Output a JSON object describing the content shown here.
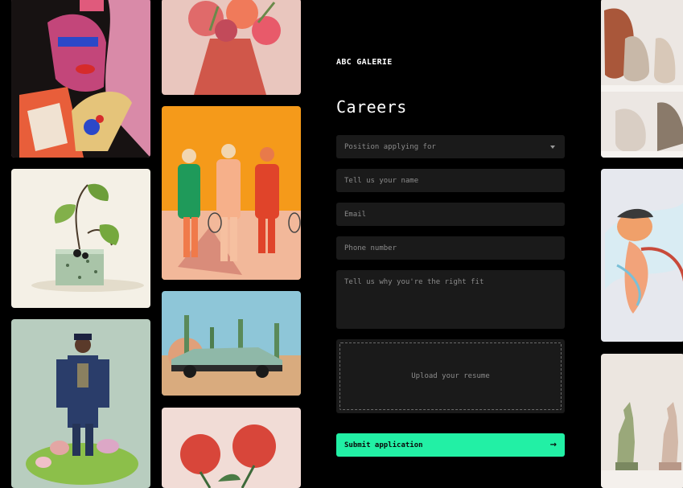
{
  "brand": "ABC GALERIE",
  "page_title": "Careers",
  "form": {
    "position_placeholder": "Position applying for",
    "name_placeholder": "Tell us your name",
    "email_placeholder": "Email",
    "phone_placeholder": "Phone number",
    "fit_placeholder": "Tell us why you're the right fit",
    "upload_label": "Upload your resume",
    "submit_label": "Submit application",
    "submit_icon": "arrow-right-icon"
  },
  "colors": {
    "background": "#000000",
    "field_bg": "#1a1a1a",
    "accent": "#22f0a5",
    "placeholder_text": "#8b8b8b"
  }
}
